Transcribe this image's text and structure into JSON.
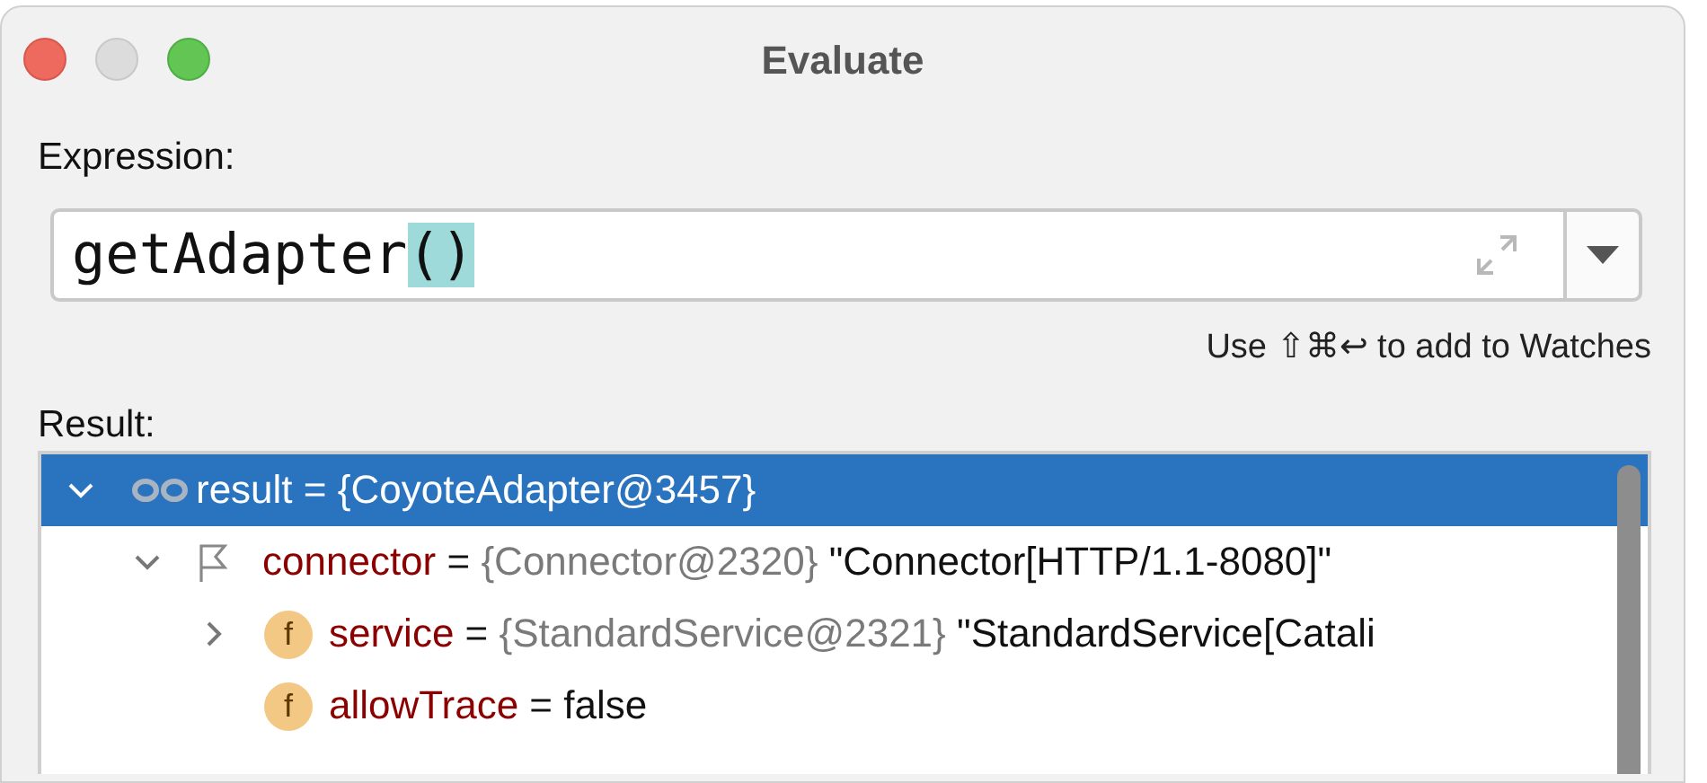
{
  "window": {
    "title": "Evaluate"
  },
  "expression": {
    "label": "Expression:",
    "text": "getAdapter",
    "highlight": "()"
  },
  "hint": "Use ⇧⌘↩ to add to Watches",
  "result": {
    "label": "Result:",
    "tree": [
      {
        "kind": "watch",
        "name": "result",
        "op": "=",
        "type": "{CoyoteAdapter@3457}",
        "selected": true,
        "expanded": true,
        "children": [
          {
            "kind": "flag",
            "name": "connector",
            "op": "=",
            "type": "{Connector@2320}",
            "value": "\"Connector[HTTP/1.1-8080]\"",
            "selected": false,
            "expanded": true,
            "children": [
              {
                "kind": "field",
                "icon_text": "f",
                "name": "service",
                "op": "=",
                "type": "{StandardService@2321}",
                "value": "\"StandardService[Catali",
                "selected": false,
                "expanded": false
              },
              {
                "kind": "field",
                "icon_text": "f",
                "name": "allowTrace",
                "op": "=",
                "value": "false",
                "selected": false
              }
            ]
          }
        ]
      }
    ]
  }
}
